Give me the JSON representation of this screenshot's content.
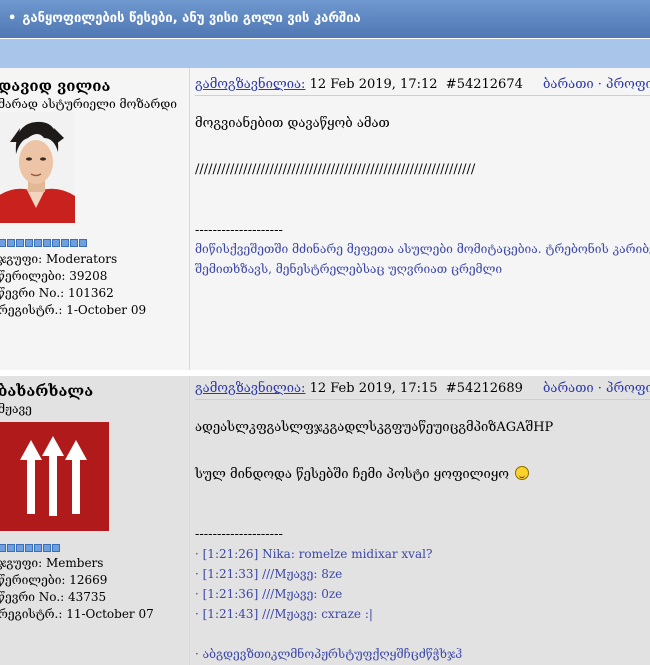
{
  "header": {
    "title": "განყოფილების წესები, ანუ ვისი გოლი ვის კარშია"
  },
  "posts": [
    {
      "user": {
        "name": "დავიდ ვილია",
        "title": "მარად ასტურიელი მოზარდი",
        "group": "ჯგუფი: Moderators",
        "posts": "წერილები: 39208",
        "member_no": "წევრი No.: 101362",
        "registered": "რეგისტრ.: 1-October 09",
        "rank_pips": 10
      },
      "meta": {
        "author_link": "გამოგზავნილია:",
        "date": "12 Feb 2019, 17:12",
        "id": "#54212674",
        "links": "ბარათი · პროფილი ·"
      },
      "body": [
        "მოგვიანებით დავაწყობ ამათ",
        "////////////////////////////////////////////////////////////////"
      ],
      "signature": {
        "divider": "--------------------",
        "lines": [
          "მიწისქვეშეთში მძინარე მეფეთა ასულები მომიტაცებია. ტრებონის კარიბჭე",
          "შემითხზავს, მენესტრელებსაც უღვრიათ ცრემლი"
        ]
      }
    },
    {
      "user": {
        "name": "ბახარხალა",
        "title": "მჟავე",
        "group": "ჯგუფი: Members",
        "posts": "წერილები: 12669",
        "member_no": "წევრი No.: 43735",
        "registered": "რეგისტრ.: 11-October 07",
        "rank_pips": 7
      },
      "meta": {
        "author_link": "გამოგზავნილია:",
        "date": "12 Feb 2019, 17:15",
        "id": "#54212689",
        "links": "ბარათი · პროფილი ·"
      },
      "body": [
        "ადეასლკფგასლფჯკგადლსკგფუაწეუიცგმპიზAGAშHP",
        "სულ მინდოდა წესებში ჩემი პოსტი ყოფილიყო"
      ],
      "signature": {
        "divider": "--------------------",
        "lines": [
          "· [1:21:26] Nika: romelze midixar xval?",
          "· [1:21:33] ///Mჟავე: 8ze",
          "· [1:21:36] ///Mჟავე: 0ze",
          "· [1:21:43] ///Mჟავე: cxraze :|",
          "· აბგდევზთიკლმნოპჟრსტუფქღყშჩცძწჭხჯჰ"
        ]
      }
    }
  ],
  "colors": {
    "header_bar": "#5a82bd",
    "sub_bar": "#a9c5e9",
    "link": "#2f3aa8",
    "avatar2_bg": "#b01a1a"
  }
}
